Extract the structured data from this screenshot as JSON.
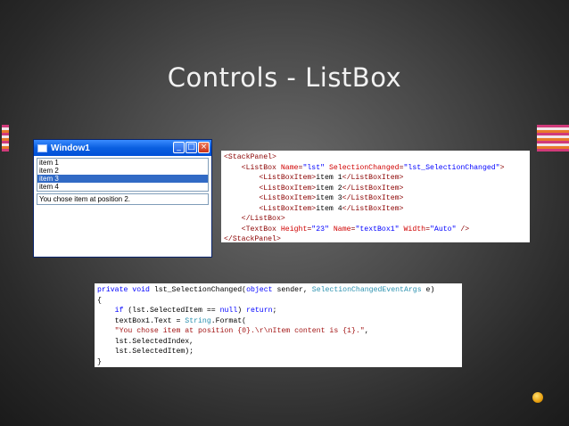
{
  "slide": {
    "title": "Controls - ListBox",
    "colors": {
      "stripe_pink": "#d03a7a",
      "stripe_orange": "#e87a2a",
      "stripe_white": "#f2e6ea"
    }
  },
  "window": {
    "title": "Window1",
    "buttons": {
      "minimize": "_",
      "maximize": "□",
      "close": "×"
    },
    "list_items": [
      "item 1",
      "item 2",
      "item 3",
      "item 4"
    ],
    "selected_index": 2,
    "textbox_text": "You chose item at position 2."
  },
  "xml_code": {
    "lines": [
      [
        {
          "c": "t-tag",
          "t": "<StackPanel>"
        }
      ],
      [
        {
          "c": "t-txt",
          "t": "    "
        },
        {
          "c": "t-tag",
          "t": "<ListBox "
        },
        {
          "c": "t-attr",
          "t": "Name"
        },
        {
          "c": "t-tag",
          "t": "="
        },
        {
          "c": "t-val",
          "t": "\"lst\""
        },
        {
          "c": "t-attr",
          "t": " SelectionChanged"
        },
        {
          "c": "t-tag",
          "t": "="
        },
        {
          "c": "t-val",
          "t": "\"lst_SelectionChanged\""
        },
        {
          "c": "t-tag",
          "t": ">"
        }
      ],
      [
        {
          "c": "t-txt",
          "t": "        "
        },
        {
          "c": "t-tag",
          "t": "<ListBoxItem>"
        },
        {
          "c": "t-txt",
          "t": "item 1"
        },
        {
          "c": "t-tag",
          "t": "</ListBoxItem>"
        }
      ],
      [
        {
          "c": "t-txt",
          "t": "        "
        },
        {
          "c": "t-tag",
          "t": "<ListBoxItem>"
        },
        {
          "c": "t-txt",
          "t": "item 2"
        },
        {
          "c": "t-tag",
          "t": "</ListBoxItem>"
        }
      ],
      [
        {
          "c": "t-txt",
          "t": "        "
        },
        {
          "c": "t-tag",
          "t": "<ListBoxItem>"
        },
        {
          "c": "t-txt",
          "t": "item 3"
        },
        {
          "c": "t-tag",
          "t": "</ListBoxItem>"
        }
      ],
      [
        {
          "c": "t-txt",
          "t": "        "
        },
        {
          "c": "t-tag",
          "t": "<ListBoxItem>"
        },
        {
          "c": "t-txt",
          "t": "item 4"
        },
        {
          "c": "t-tag",
          "t": "</ListBoxItem>"
        }
      ],
      [
        {
          "c": "t-txt",
          "t": "    "
        },
        {
          "c": "t-tag",
          "t": "</ListBox>"
        }
      ],
      [
        {
          "c": "t-txt",
          "t": "    "
        },
        {
          "c": "t-tag",
          "t": "<TextBox "
        },
        {
          "c": "t-attr",
          "t": "Height"
        },
        {
          "c": "t-tag",
          "t": "="
        },
        {
          "c": "t-val",
          "t": "\"23\""
        },
        {
          "c": "t-attr",
          "t": " Name"
        },
        {
          "c": "t-tag",
          "t": "="
        },
        {
          "c": "t-val",
          "t": "\"textBox1\""
        },
        {
          "c": "t-attr",
          "t": " Width"
        },
        {
          "c": "t-tag",
          "t": "="
        },
        {
          "c": "t-val",
          "t": "\"Auto\""
        },
        {
          "c": "t-tag",
          "t": " />"
        }
      ],
      [
        {
          "c": "t-tag",
          "t": "</StackPanel>"
        }
      ]
    ]
  },
  "cs_code": {
    "lines": [
      [
        {
          "c": "t-kw",
          "t": "private void"
        },
        {
          "c": "t-txt",
          "t": " lst_SelectionChanged("
        },
        {
          "c": "t-kw",
          "t": "object"
        },
        {
          "c": "t-txt",
          "t": " sender, "
        },
        {
          "c": "t-type",
          "t": "SelectionChangedEventArgs"
        },
        {
          "c": "t-txt",
          "t": " e)"
        }
      ],
      [
        {
          "c": "t-txt",
          "t": "{"
        }
      ],
      [
        {
          "c": "t-txt",
          "t": "    "
        },
        {
          "c": "t-kw",
          "t": "if"
        },
        {
          "c": "t-txt",
          "t": " (lst.SelectedItem == "
        },
        {
          "c": "t-kw",
          "t": "null"
        },
        {
          "c": "t-txt",
          "t": ") "
        },
        {
          "c": "t-kw",
          "t": "return"
        },
        {
          "c": "t-txt",
          "t": ";"
        }
      ],
      [
        {
          "c": "t-txt",
          "t": "    textBox1.Text = "
        },
        {
          "c": "t-type",
          "t": "String"
        },
        {
          "c": "t-txt",
          "t": ".Format("
        }
      ],
      [
        {
          "c": "t-txt",
          "t": "    "
        },
        {
          "c": "t-str",
          "t": "\"You chose item at position {0}.\\r\\nItem content is {1}.\""
        },
        {
          "c": "t-txt",
          "t": ","
        }
      ],
      [
        {
          "c": "t-txt",
          "t": "    lst.SelectedIndex,"
        }
      ],
      [
        {
          "c": "t-txt",
          "t": "    lst.SelectedItem);"
        }
      ],
      [
        {
          "c": "t-txt",
          "t": "}"
        }
      ]
    ]
  }
}
